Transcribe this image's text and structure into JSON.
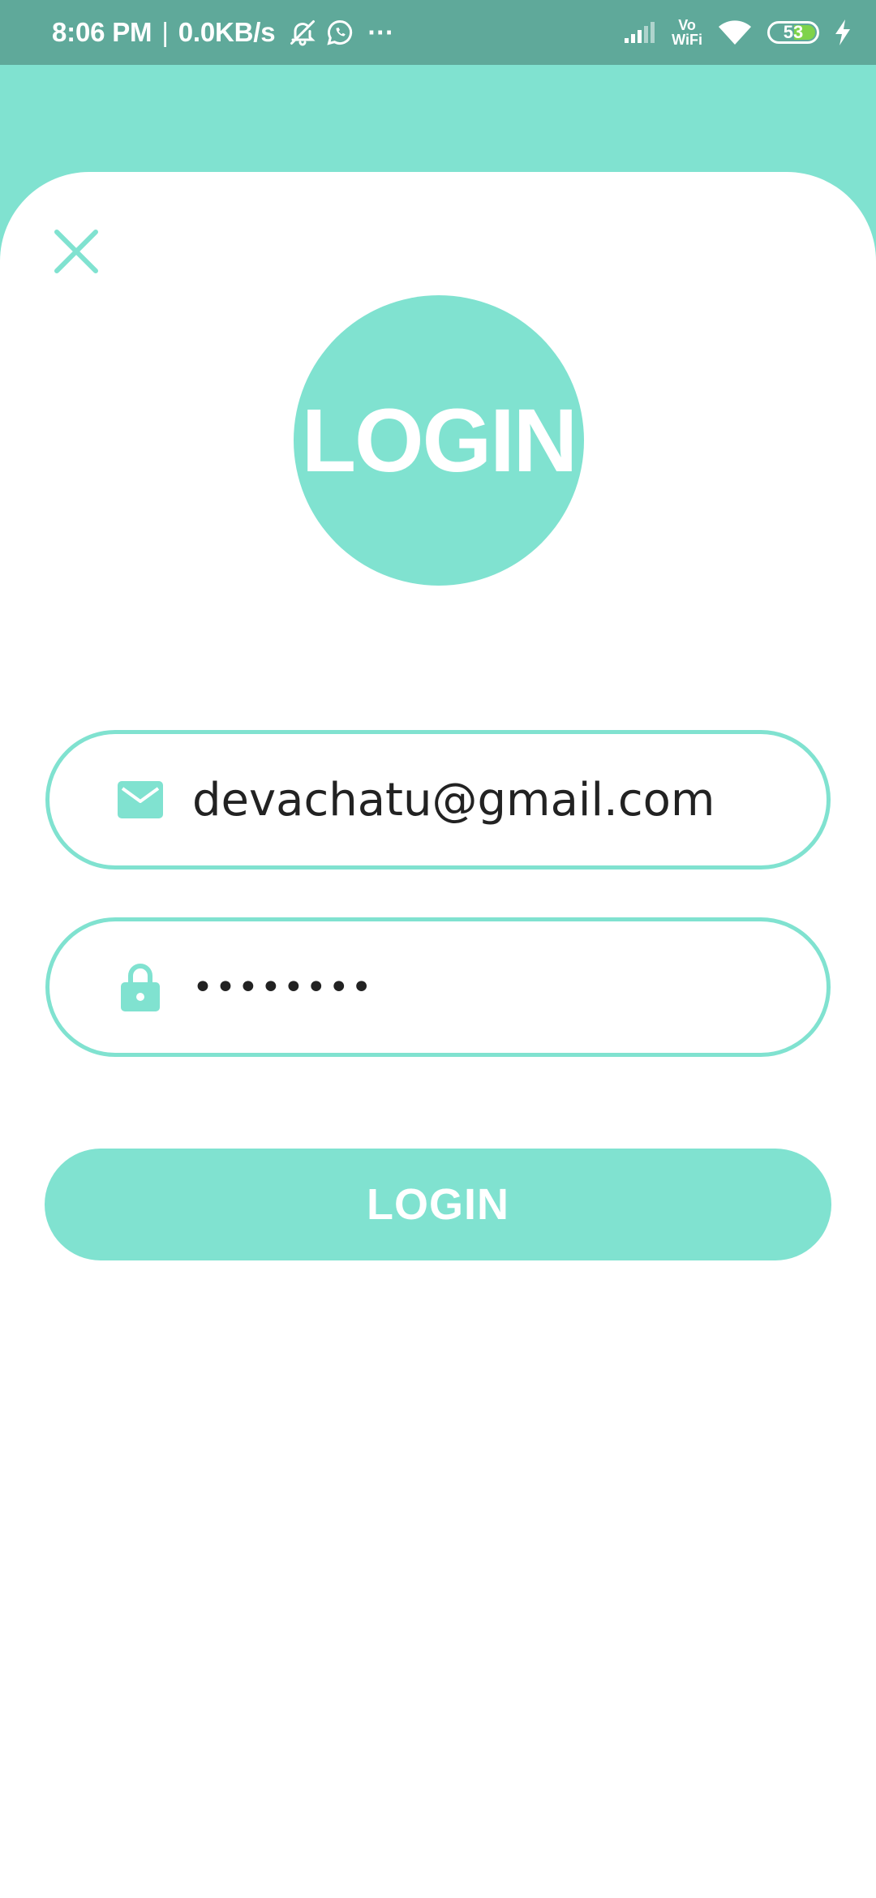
{
  "status_bar": {
    "time": "8:06 PM",
    "separator": "|",
    "network_speed": "0.0KB/s",
    "more": "···",
    "vowifi_top": "Vo",
    "vowifi_bottom": "WiFi",
    "battery_level": "53",
    "icons": [
      "mute-icon",
      "whatsapp-icon",
      "signal-icon",
      "wifi-icon",
      "battery-icon",
      "charging-icon"
    ]
  },
  "logo": {
    "text": "LOGIN"
  },
  "form": {
    "email_value": "devachatu@gmail.com",
    "password_value": "••••••••",
    "email_icon": "mail-icon",
    "password_icon": "lock-icon"
  },
  "actions": {
    "login_label": "LOGIN",
    "close_icon": "close-icon"
  },
  "colors": {
    "accent": "#80e2d0",
    "status_bar": "#5fa99a",
    "background": "#ffffff",
    "text": "#222222"
  }
}
